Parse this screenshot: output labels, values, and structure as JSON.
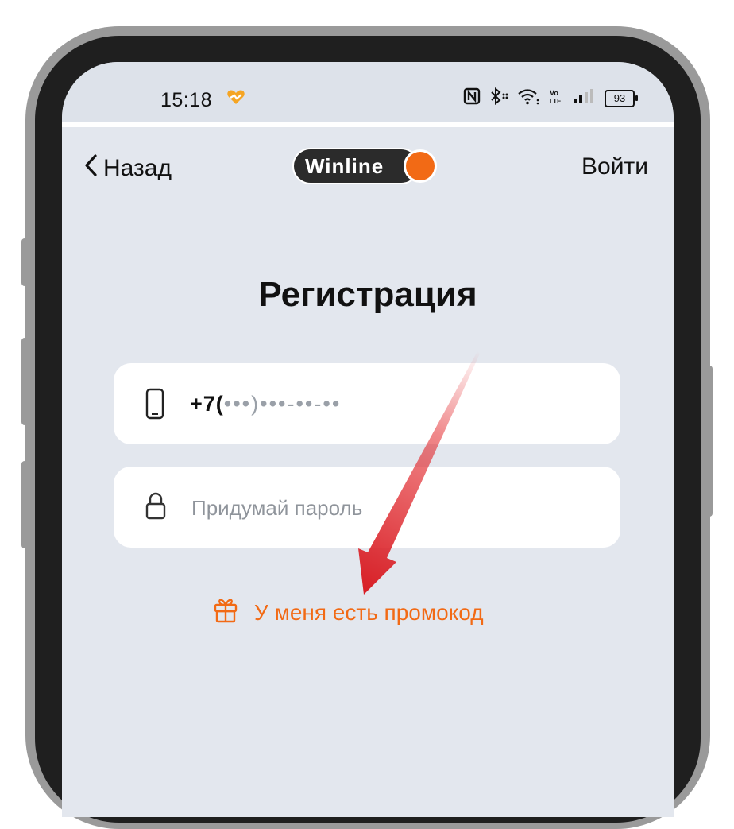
{
  "status_bar": {
    "time": "15:18",
    "battery_level": "93",
    "icons": [
      "nfc-icon",
      "bluetooth-icon",
      "wifi-icon",
      "volte-icon",
      "signal-icon",
      "battery-icon"
    ]
  },
  "nav": {
    "back_label": "Назад",
    "login_label": "Войти",
    "logo_text": "Winline"
  },
  "page": {
    "title": "Регистрация"
  },
  "form": {
    "phone_prefix": "+7(",
    "phone_mask_grey": "•••",
    "phone_mask": ")•••-••-••",
    "password_placeholder": "Придумай пароль"
  },
  "promo": {
    "label": "У меня есть промокод"
  },
  "colors": {
    "accent": "#f26a15",
    "screen_bg": "#e3e7ee",
    "field_bg": "#ffffff",
    "annotation_arrow": "#e3262a"
  }
}
